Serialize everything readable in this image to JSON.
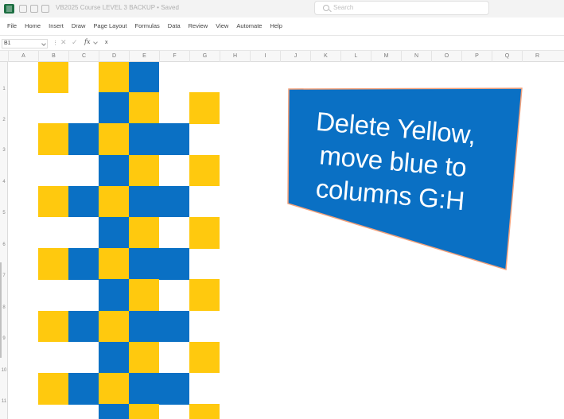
{
  "titlebar": {
    "document_title": "VB2025 Course LEVEL 3 BACKUP • Saved",
    "search_label": "Search"
  },
  "ribbon": {
    "tabs": [
      "File",
      "Home",
      "Insert",
      "Draw",
      "Page Layout",
      "Formulas",
      "Data",
      "Review",
      "View",
      "Automate",
      "Help"
    ]
  },
  "formula_bar": {
    "name_box": "B1",
    "cancel_glyph": "✕",
    "enter_glyph": "✓",
    "fx_label": "fx",
    "separator": "⋮",
    "formula": "x"
  },
  "columns": [
    "A",
    "B",
    "C",
    "D",
    "E",
    "F",
    "G",
    "H",
    "I",
    "J",
    "K",
    "L",
    "M",
    "N",
    "O",
    "P",
    "Q",
    "R"
  ],
  "rows": [
    "1",
    "2",
    "3",
    "4",
    "5",
    "6",
    "7",
    "8",
    "9",
    "10",
    "11"
  ],
  "colors": {
    "yellow": "#ffc90e",
    "blue": "#0a70c4",
    "shape_fill": "#0a70c4",
    "shape_border": "#f2a07a"
  },
  "pattern": [
    [
      "y",
      "",
      "y",
      "b",
      "",
      ""
    ],
    [
      "",
      "",
      "b",
      "y",
      "",
      "y"
    ],
    [
      "y",
      "b",
      "y",
      "b",
      "b",
      ""
    ],
    [
      "",
      "",
      "b",
      "y",
      "",
      "y"
    ],
    [
      "y",
      "b",
      "y",
      "b",
      "b",
      ""
    ],
    [
      "",
      "",
      "b",
      "y",
      "",
      "y"
    ],
    [
      "y",
      "b",
      "y",
      "b",
      "b",
      ""
    ],
    [
      "",
      "",
      "b",
      "y",
      "",
      "y"
    ],
    [
      "y",
      "b",
      "y",
      "b",
      "b",
      ""
    ],
    [
      "",
      "",
      "b",
      "y",
      "",
      "y"
    ],
    [
      "y",
      "b",
      "y",
      "b",
      "b",
      ""
    ],
    [
      "",
      "",
      "b",
      "y",
      "",
      "y"
    ]
  ],
  "shape": {
    "lines": [
      "Delete Yellow,",
      "move blue to",
      "columns G:H"
    ]
  }
}
